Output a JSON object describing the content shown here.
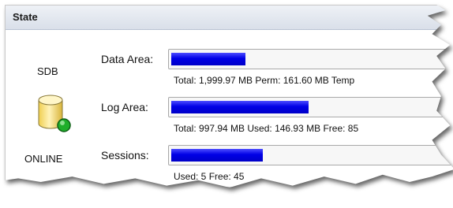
{
  "panel": {
    "title": "State"
  },
  "database": {
    "name": "SDB",
    "status": "ONLINE",
    "icon": "database-online-icon"
  },
  "rows": [
    {
      "label": "Data Area:",
      "fill": 0.26,
      "detail": "Total: 1,999.97 MB Perm: 161.60 MB Temp"
    },
    {
      "label": "Log Area:",
      "fill": 0.48,
      "detail": "Total: 997.94 MB Used: 146.93 MB Free: 85"
    },
    {
      "label": "Sessions:",
      "fill": 0.32,
      "detail": "Used: 5 Free: 45"
    }
  ],
  "colors": {
    "bar": "#0000e6",
    "header": "#dde3ec",
    "status_dot": "#1fae2a",
    "cylinder": "#f5d86a"
  }
}
